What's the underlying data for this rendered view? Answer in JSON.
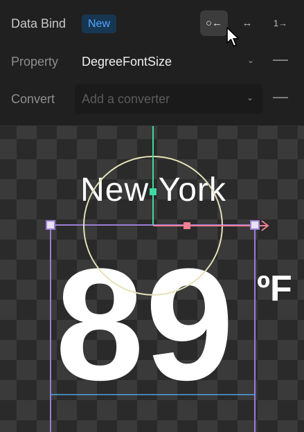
{
  "data_bind": {
    "label": "Data Bind",
    "badge": "New",
    "modes": [
      {
        "label": "○←",
        "icon": "bind-source-to-target-icon",
        "active": true
      },
      {
        "label": "↔",
        "icon": "bind-two-way-icon",
        "active": false
      },
      {
        "label": "1→",
        "icon": "bind-once-icon",
        "active": false
      }
    ]
  },
  "property": {
    "label": "Property",
    "value": "DegreeFontSize"
  },
  "convert": {
    "label": "Convert",
    "placeholder": "Add a converter"
  },
  "canvas": {
    "city": "New York",
    "temperature": "89",
    "unit": "ºF"
  },
  "colors": {
    "accent": "#52a7ff",
    "selection": "#9b7fd6",
    "axis_y": "#3ddba0",
    "axis_x": "#f07f8f",
    "rotation_ring": "#e6e1b8"
  }
}
